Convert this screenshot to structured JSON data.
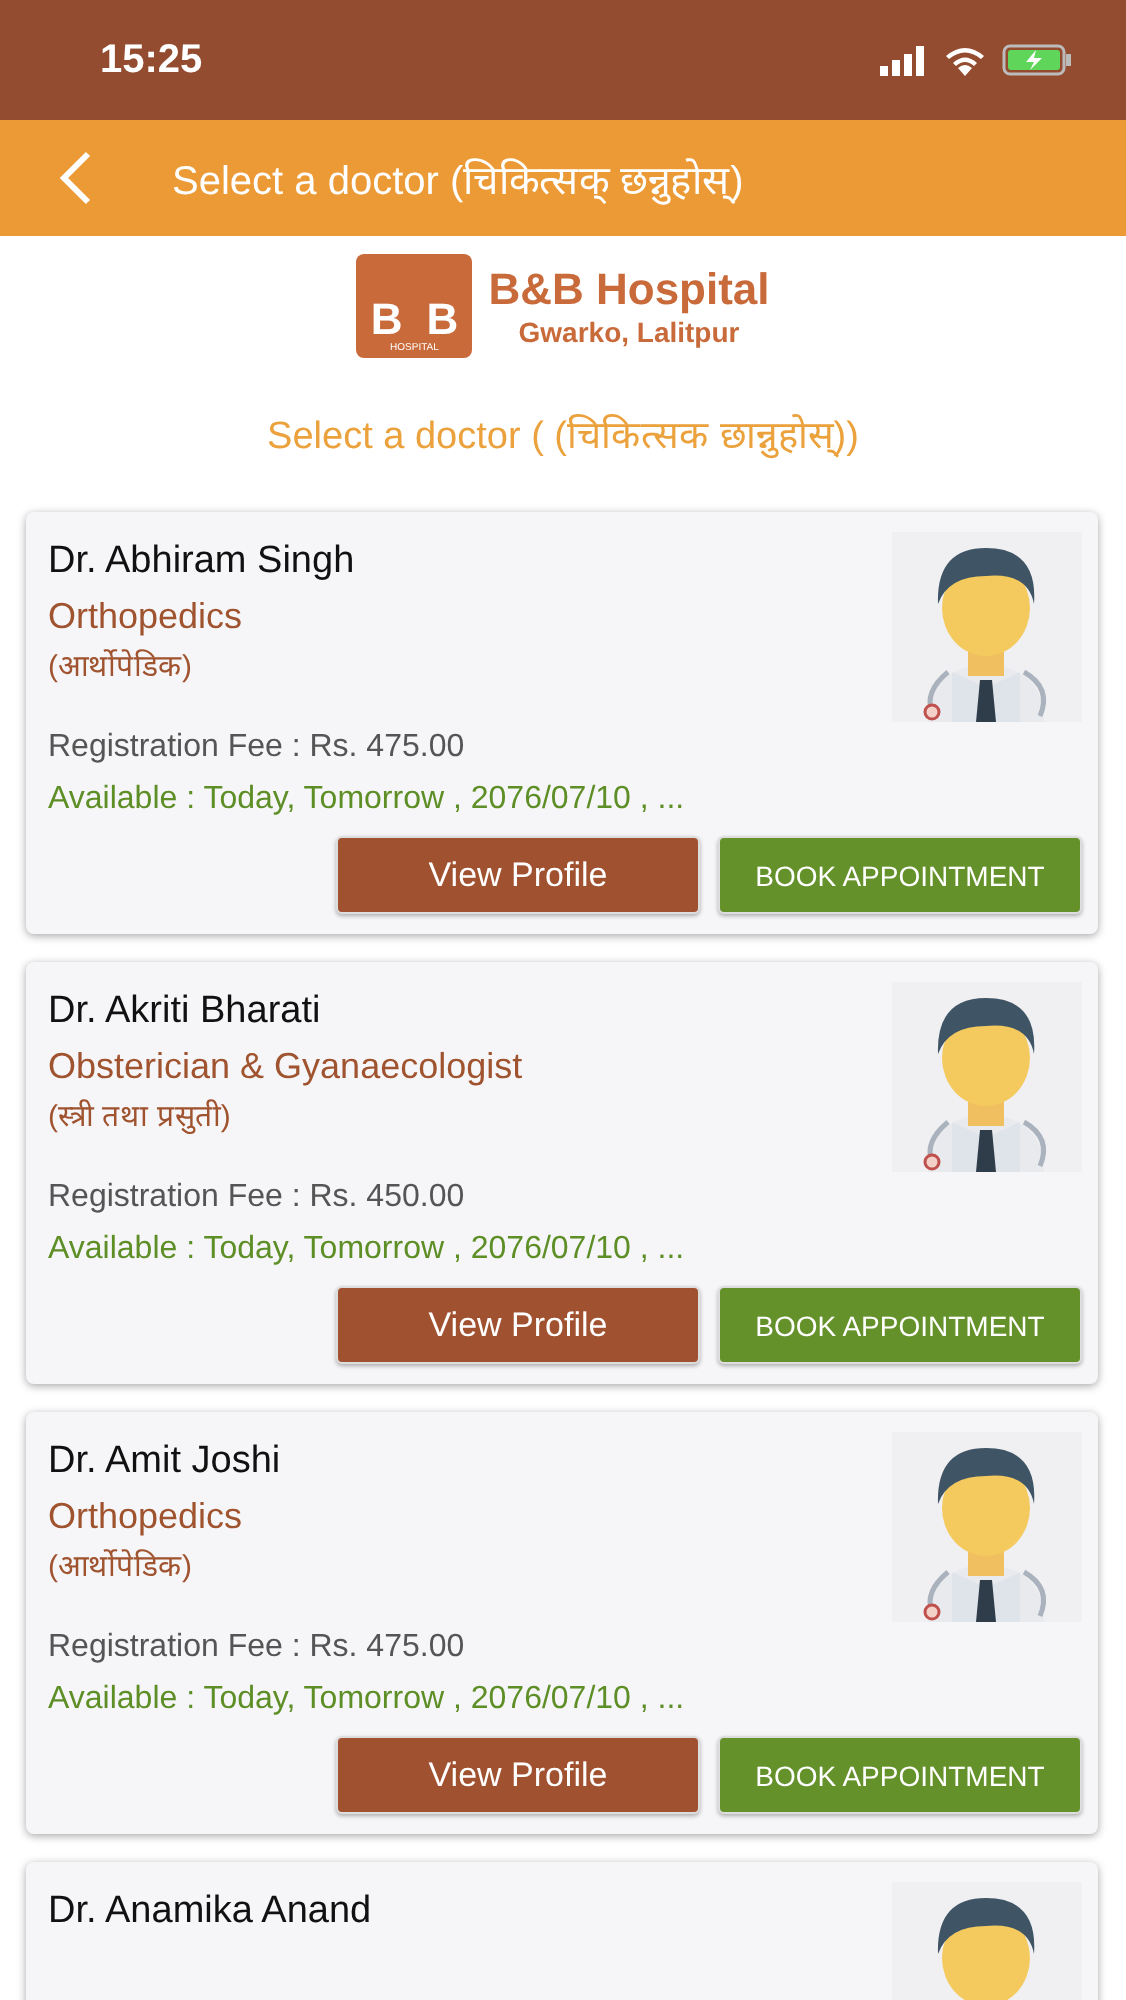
{
  "status_bar": {
    "time": "15:25"
  },
  "app_bar": {
    "title": "Select a doctor (चिकित्सक् छन्नुहोस्)"
  },
  "logo": {
    "mark_letters": [
      "B",
      "B"
    ],
    "mark_caption": "HOSPITAL",
    "name": "B&B Hospital",
    "location": "Gwarko, Lalitpur"
  },
  "heading": "Select a doctor ( (चिकित्सक छान्नुहोस्))",
  "doctors": [
    {
      "name": "Dr. Abhiram Singh",
      "specialty": "Orthopedics",
      "specialty_local": "(आर्थोपेडिक)",
      "fee": "Registration Fee : Rs. 475.00",
      "available": "Available : Today, Tomorrow , 2076/07/10 , ...",
      "view_button": "View Profile",
      "book_button": "BOOK APPOINTMENT"
    },
    {
      "name": "Dr. Akriti Bharati",
      "specialty": "Obsterician & Gyanaecologist",
      "specialty_local": "(स्त्री तथा प्रसुती)",
      "fee": "Registration Fee : Rs. 450.00",
      "available": "Available : Today, Tomorrow , 2076/07/10 , ...",
      "view_button": "View Profile",
      "book_button": "BOOK APPOINTMENT"
    },
    {
      "name": "Dr. Amit Joshi",
      "specialty": "Orthopedics",
      "specialty_local": "(आर्थोपेडिक)",
      "fee": "Registration Fee : Rs. 475.00",
      "available": "Available : Today, Tomorrow , 2076/07/10 , ...",
      "view_button": "View Profile",
      "book_button": "BOOK APPOINTMENT"
    },
    {
      "name": "Dr. Anamika Anand"
    }
  ]
}
